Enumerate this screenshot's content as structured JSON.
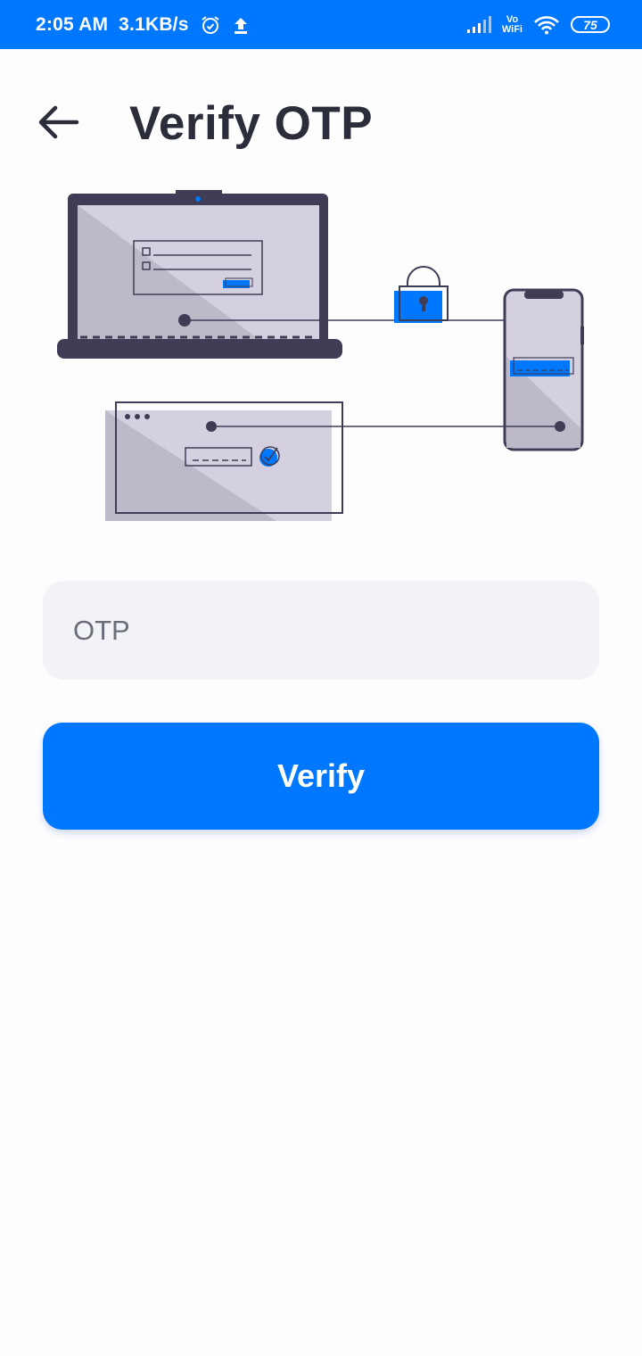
{
  "status_bar": {
    "time": "2:05 AM",
    "net_speed": "3.1KB/s",
    "volte_top": "Vo",
    "volte_bottom": "WiFi",
    "battery": "75"
  },
  "header": {
    "title": "Verify OTP",
    "back_icon": "arrow-left-icon"
  },
  "otp": {
    "value": "",
    "placeholder": "OTP"
  },
  "verify_button": {
    "label": "Verify"
  },
  "colors": {
    "primary": "#0077ff",
    "title": "#2b2d3b",
    "field_bg": "#f2f3f7",
    "illustration_dark": "#3f3d56",
    "illustration_light": "#d4d0e0"
  }
}
